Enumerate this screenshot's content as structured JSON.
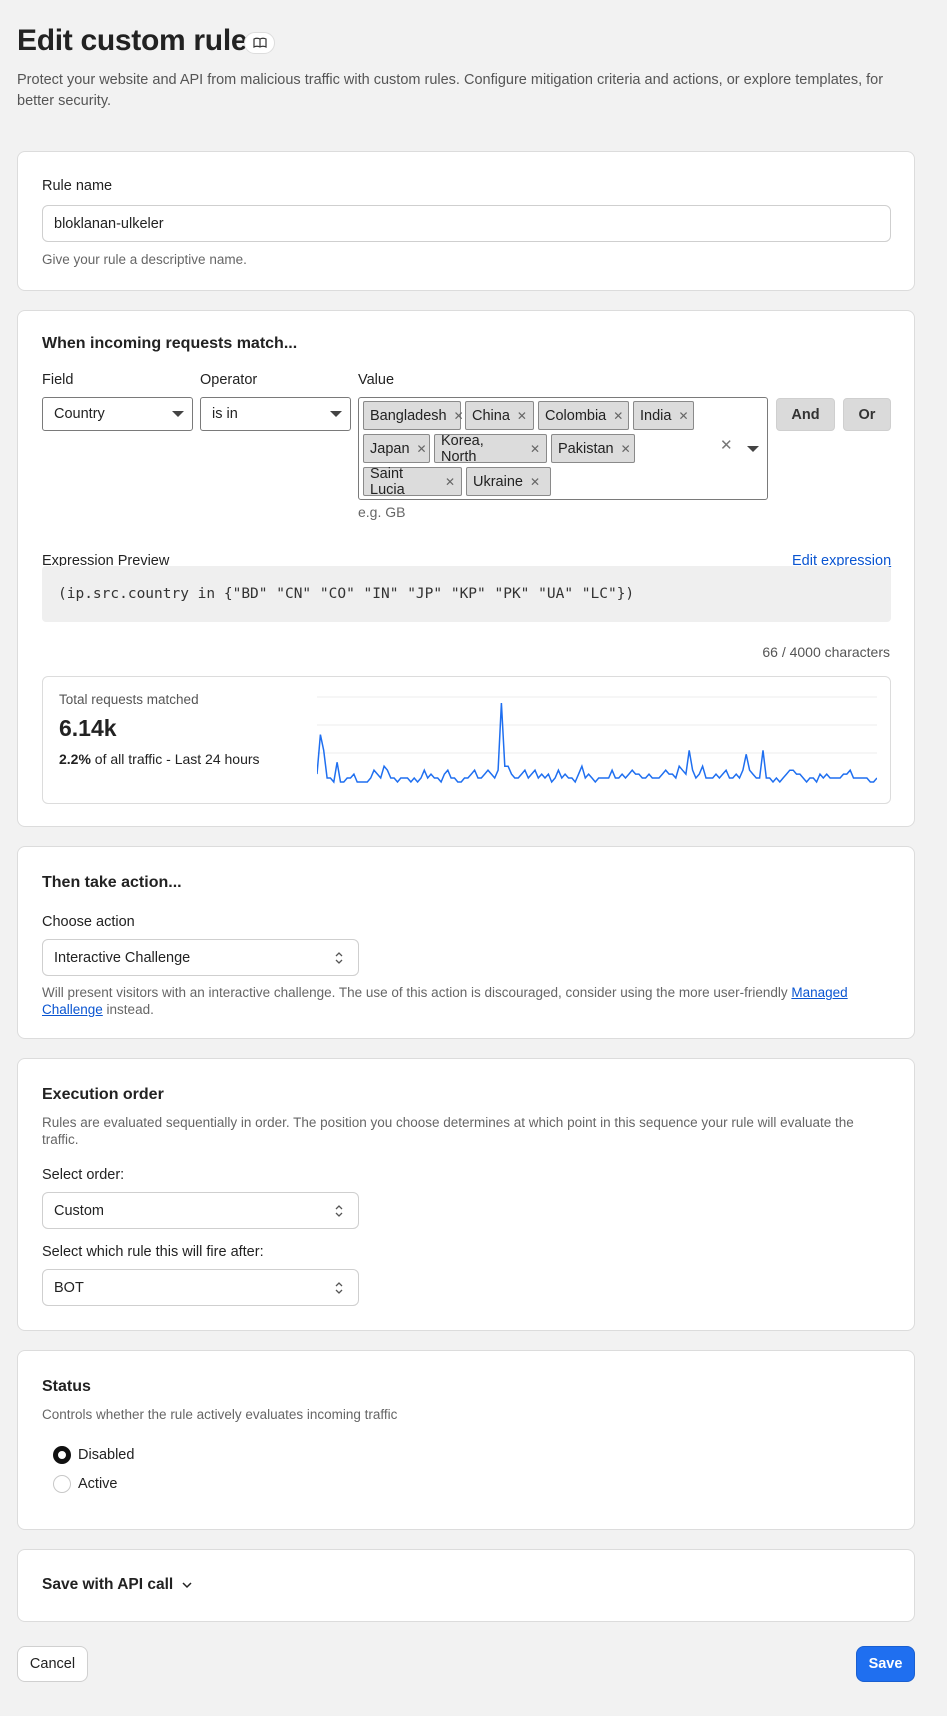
{
  "page": {
    "title": "Edit custom rule",
    "description": "Protect your website and API from malicious traffic with custom rules. Configure mitigation criteria and actions, or explore templates, for better security."
  },
  "rule_name": {
    "label": "Rule name",
    "value": "bloklanan-ulkeler",
    "help": "Give your rule a descriptive name."
  },
  "match": {
    "title": "When incoming requests match...",
    "field_label": "Field",
    "field_value": "Country",
    "operator_label": "Operator",
    "operator_value": "is in",
    "value_label": "Value",
    "chips": [
      "Bangladesh",
      "China",
      "Colombia",
      "India",
      "Japan",
      "Korea, North",
      "Pakistan",
      "Saint Lucia",
      "Ukraine"
    ],
    "value_hint": "e.g. GB",
    "and_label": "And",
    "or_label": "Or",
    "expression_label": "Expression Preview",
    "edit_expression": "Edit expression",
    "expression": "(ip.src.country in {\"BD\" \"CN\" \"CO\" \"IN\" \"JP\" \"KP\" \"PK\" \"UA\" \"LC\"})",
    "char_count": "66 / 4000 characters"
  },
  "stats": {
    "label": "Total requests matched",
    "total": "6.14k",
    "percent": "2.2%",
    "suffix": " of all traffic - Last 24 hours",
    "line_color": "#1f6ff0"
  },
  "chart_data": {
    "type": "line",
    "title": "",
    "xlabel": "",
    "ylabel": "",
    "grid": true,
    "series": [
      {
        "values": [
          2,
          12,
          8,
          1,
          1,
          0,
          5,
          0,
          0,
          1,
          1,
          2,
          0,
          0,
          0,
          0,
          1,
          3,
          2,
          1,
          4,
          3,
          1,
          1,
          0,
          1,
          1,
          1,
          0,
          1,
          0,
          1,
          3,
          1,
          2,
          1,
          1,
          0,
          2,
          3,
          1,
          1,
          0,
          0,
          1,
          1,
          2,
          3,
          1,
          1,
          2,
          3,
          2,
          1,
          3,
          20,
          4,
          4,
          2,
          1,
          1,
          2,
          3,
          1,
          2,
          3,
          1,
          2,
          1,
          2,
          0,
          1,
          3,
          1,
          2,
          1,
          1,
          0,
          2,
          4,
          1,
          2,
          1,
          0,
          1,
          1,
          1,
          1,
          3,
          1,
          1,
          2,
          1,
          2,
          3,
          2,
          2,
          1,
          1,
          2,
          1,
          1,
          1,
          2,
          3,
          2,
          2,
          1,
          4,
          3,
          2,
          8,
          3,
          1,
          2,
          4,
          1,
          1,
          1,
          2,
          1,
          2,
          3,
          1,
          1,
          2,
          1,
          3,
          7,
          3,
          2,
          1,
          1,
          8,
          1,
          1,
          0,
          1,
          0,
          1,
          2,
          3,
          3,
          2,
          2,
          1,
          0,
          1,
          1,
          0,
          2,
          1,
          2,
          1,
          1,
          1,
          1,
          2,
          2,
          3,
          1,
          1,
          1,
          1,
          1,
          0,
          0,
          1
        ]
      }
    ]
  },
  "action": {
    "title": "Then take action...",
    "choose_label": "Choose action",
    "value": "Interactive Challenge",
    "help_text": "Will present visitors with an interactive challenge. The use of this action is discouraged, consider using the more user-friendly ",
    "help_link": "Managed Challenge",
    "help_suffix": " instead."
  },
  "execution": {
    "title": "Execution order",
    "description": "Rules are evaluated sequentially in order. The position you choose determines at which point in this sequence your rule will evaluate the traffic.",
    "order_label": "Select order:",
    "order_value": "Custom",
    "after_label": "Select which rule this will fire after:",
    "after_value": "BOT"
  },
  "status": {
    "title": "Status",
    "description": "Controls whether the rule actively evaluates incoming traffic",
    "options": [
      "Disabled",
      "Active"
    ],
    "selected": "Disabled"
  },
  "api": {
    "label": "Save with API call"
  },
  "footer": {
    "cancel": "Cancel",
    "save": "Save"
  }
}
